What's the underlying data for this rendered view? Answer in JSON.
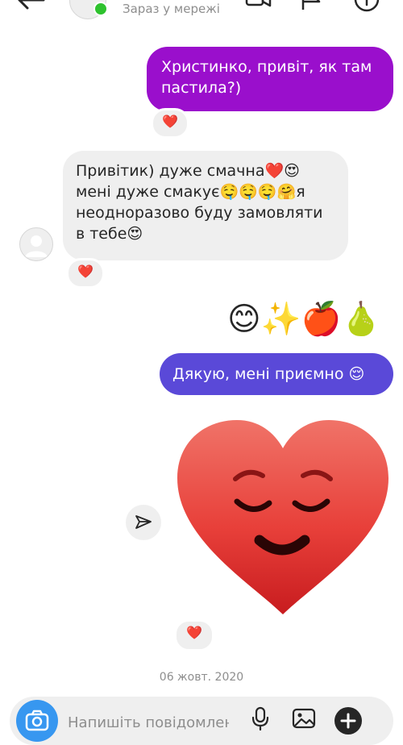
{
  "header": {
    "status": "Зараз у мережі",
    "icons": [
      "back-arrow-icon",
      "video-call-icon",
      "flag-icon",
      "info-icon"
    ]
  },
  "messages": [
    {
      "sender": "me",
      "text": "Христинко, привіт, як там пастила?)",
      "reaction": "❤️"
    },
    {
      "sender": "them",
      "text": "Привітик) дуже смачна❤️😍 мені дуже смакує🤤🤤🤤🤗я неодноразово буду замовляти в тебе😍",
      "reaction": "❤️"
    },
    {
      "sender": "me",
      "text": "😊✨🍎🍐"
    },
    {
      "sender": "me",
      "text": "Дякую, мені приємно 😌"
    },
    {
      "sender": "me",
      "sticker": "heart-relieved-face",
      "reaction": "❤️"
    }
  ],
  "date_separator": "06 жовт. 2020",
  "composer": {
    "placeholder": "Напишіть повідомлення...",
    "icons": [
      "camera-icon",
      "mic-icon",
      "image-icon",
      "plus-icon"
    ]
  },
  "colors": {
    "outgoing_purple": "#9a0fcc",
    "outgoing_blue": "#5a49d8",
    "incoming_gray": "#efefef",
    "online_green": "#2ec22e",
    "camera_blue": "#3797f0",
    "heart_red": "#e8403a"
  }
}
